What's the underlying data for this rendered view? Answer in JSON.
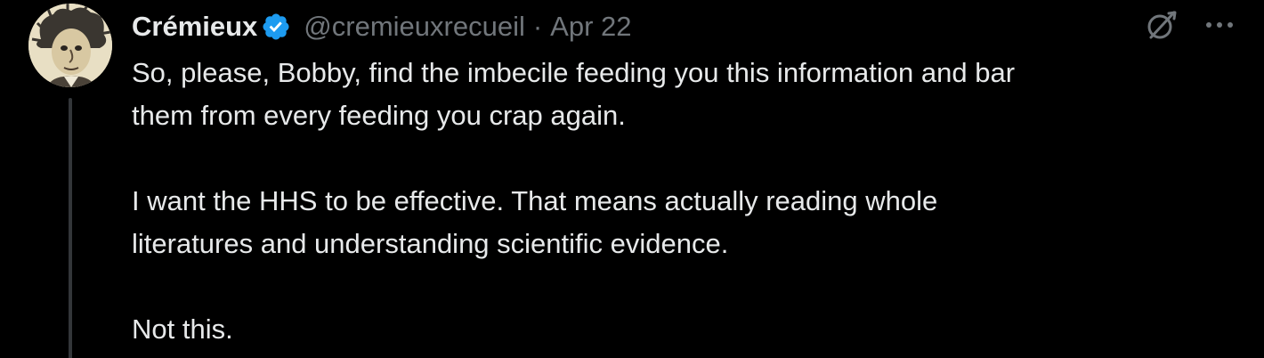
{
  "tweet": {
    "author": {
      "display_name": "Crémieux",
      "handle": "@cremieuxrecueil",
      "verified": true
    },
    "separator": "·",
    "date": "Apr 22",
    "paragraphs": [
      "So, please, Bobby, find the imbecile feeding you this information and bar\nthem from every feeding you crap again.",
      "I want the HHS to be effective. That means actually reading whole\nliteratures and understanding scientific evidence.",
      "Not this."
    ]
  },
  "icons": {
    "verified": "verified-badge-icon",
    "grok": "grok-icon",
    "more": "more-options-icon"
  },
  "colors": {
    "background": "#000000",
    "text_primary": "#e7e9ea",
    "text_secondary": "#71767b",
    "verified_blue": "#1d9bf0",
    "thread_line": "#333639"
  }
}
